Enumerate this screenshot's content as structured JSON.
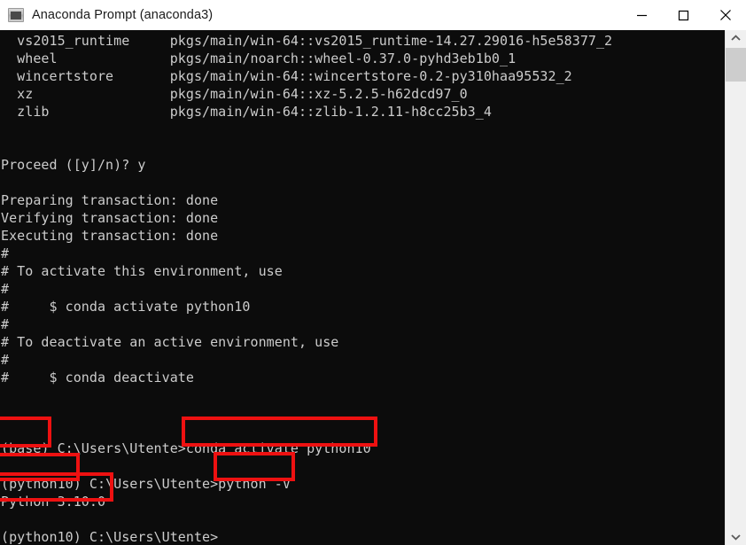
{
  "window": {
    "title": "Anaconda Prompt (anaconda3)",
    "icon": "console-icon",
    "background_color": "#0c0c0c",
    "text_color": "#cccccc",
    "titlebar_color": "#ffffff"
  },
  "titlebar": {
    "minimize_label": "—",
    "maximize_label": "□",
    "close_label": "✕"
  },
  "scrollbar": {
    "up_arrow": "chevron-up-icon",
    "down_arrow": "chevron-down-icon",
    "thumb_position_percent": 3
  },
  "annotations": {
    "color": "#ee1111",
    "boxes": [
      {
        "name": "highlight-base-env",
        "label": "(base)"
      },
      {
        "name": "highlight-conda-activate-command",
        "label": "conda activate python10"
      },
      {
        "name": "highlight-python10-env",
        "label": "(python10)"
      },
      {
        "name": "highlight-python-version-command",
        "label": "python -V"
      },
      {
        "name": "highlight-python-version-output",
        "label": "Python 3.10.0"
      }
    ]
  },
  "console": {
    "lines": [
      "  vs2015_runtime     pkgs/main/win-64::vs2015_runtime-14.27.29016-h5e58377_2",
      "  wheel              pkgs/main/noarch::wheel-0.37.0-pyhd3eb1b0_1",
      "  wincertstore       pkgs/main/win-64::wincertstore-0.2-py310haa95532_2",
      "  xz                 pkgs/main/win-64::xz-5.2.5-h62dcd97_0",
      "  zlib               pkgs/main/win-64::zlib-1.2.11-h8cc25b3_4",
      "",
      "",
      "Proceed ([y]/n)? y",
      "",
      "Preparing transaction: done",
      "Verifying transaction: done",
      "Executing transaction: done",
      "#",
      "# To activate this environment, use",
      "#",
      "#     $ conda activate python10",
      "#",
      "# To deactivate an active environment, use",
      "#",
      "#     $ conda deactivate",
      "",
      "",
      "",
      "(base) C:\\Users\\Utente>conda activate python10",
      "",
      "(python10) C:\\Users\\Utente>python -V",
      "Python 3.10.0",
      "",
      "(python10) C:\\Users\\Utente>"
    ]
  }
}
